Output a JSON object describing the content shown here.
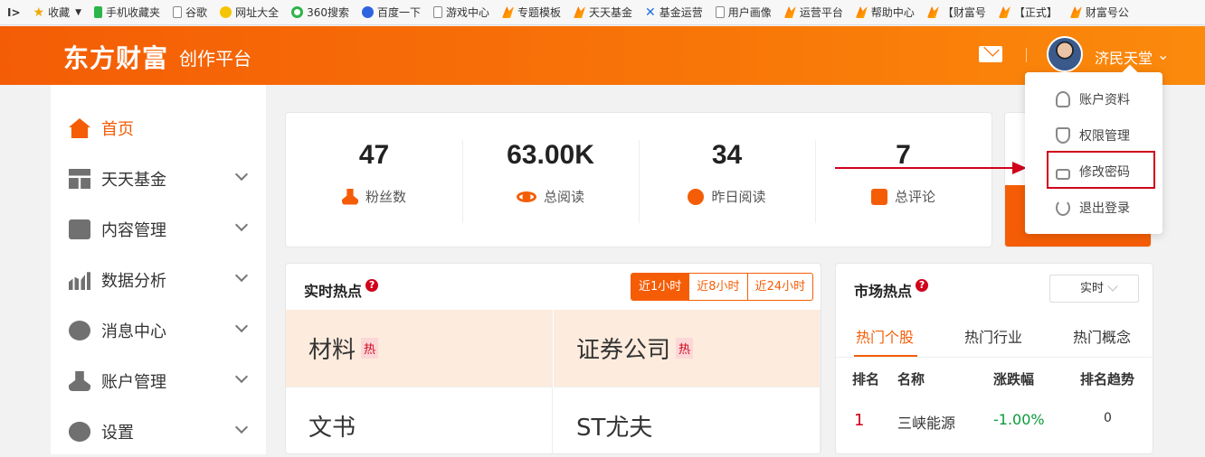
{
  "bookmarks": [
    {
      "label": "收藏",
      "icon": "star-icon"
    },
    {
      "label": "手机收藏夹",
      "icon": "phone-icon"
    },
    {
      "label": "谷歌",
      "icon": "page-icon"
    },
    {
      "label": "网址大全",
      "icon": "web-icon"
    },
    {
      "label": "360搜索",
      "icon": "360-icon"
    },
    {
      "label": "百度一下",
      "icon": "baidu-icon"
    },
    {
      "label": "游戏中心",
      "icon": "page-icon"
    },
    {
      "label": "专题模板",
      "icon": "flame-icon"
    },
    {
      "label": "天天基金",
      "icon": "flame-icon"
    },
    {
      "label": "基金运营",
      "icon": "x-icon"
    },
    {
      "label": "用户画像",
      "icon": "page-icon"
    },
    {
      "label": "运营平台",
      "icon": "flame-icon"
    },
    {
      "label": "帮助中心",
      "icon": "flame-icon"
    },
    {
      "label": "【财富号",
      "icon": "flame-icon"
    },
    {
      "label": "【正式】",
      "icon": "flame-icon"
    },
    {
      "label": "财富号公",
      "icon": "flame-icon"
    }
  ],
  "header": {
    "logo": "东方财富",
    "subtitle": "创作平台",
    "username": "济民天堂"
  },
  "sidebar": {
    "items": [
      {
        "label": "首页"
      },
      {
        "label": "天天基金"
      },
      {
        "label": "内容管理"
      },
      {
        "label": "数据分析"
      },
      {
        "label": "消息中心"
      },
      {
        "label": "账户管理"
      },
      {
        "label": "设置"
      }
    ]
  },
  "stats": [
    {
      "value": "47",
      "label": "粉丝数"
    },
    {
      "value": "63.00K",
      "label": "总阅读"
    },
    {
      "value": "34",
      "label": "昨日阅读"
    },
    {
      "value": "7",
      "label": "总评论"
    }
  ],
  "user_menu": {
    "items": [
      {
        "label": "账户资料"
      },
      {
        "label": "权限管理"
      },
      {
        "label": "修改密码"
      },
      {
        "label": "退出登录"
      }
    ]
  },
  "hot_now": {
    "title": "实时热点",
    "help": "?",
    "tabs": [
      "近1小时",
      "近8小时",
      "近24小时"
    ],
    "hot_tag": "热",
    "items": [
      "材料",
      "证券公司",
      "文书",
      "ST尤夫"
    ]
  },
  "market_hot": {
    "title": "市场热点",
    "help": "?",
    "select_value": "实时",
    "tabs": [
      "热门个股",
      "热门行业",
      "热门概念"
    ],
    "columns": [
      "排名",
      "名称",
      "涨跌幅",
      "排名趋势"
    ],
    "rows": [
      {
        "rank": "1",
        "name": "三峡能源",
        "change": "-1.00%",
        "trend": "0"
      }
    ]
  },
  "colors": {
    "brand": "#f45d06",
    "annotation_red": "#d0021b",
    "negative_change": "#0a9a3a"
  }
}
